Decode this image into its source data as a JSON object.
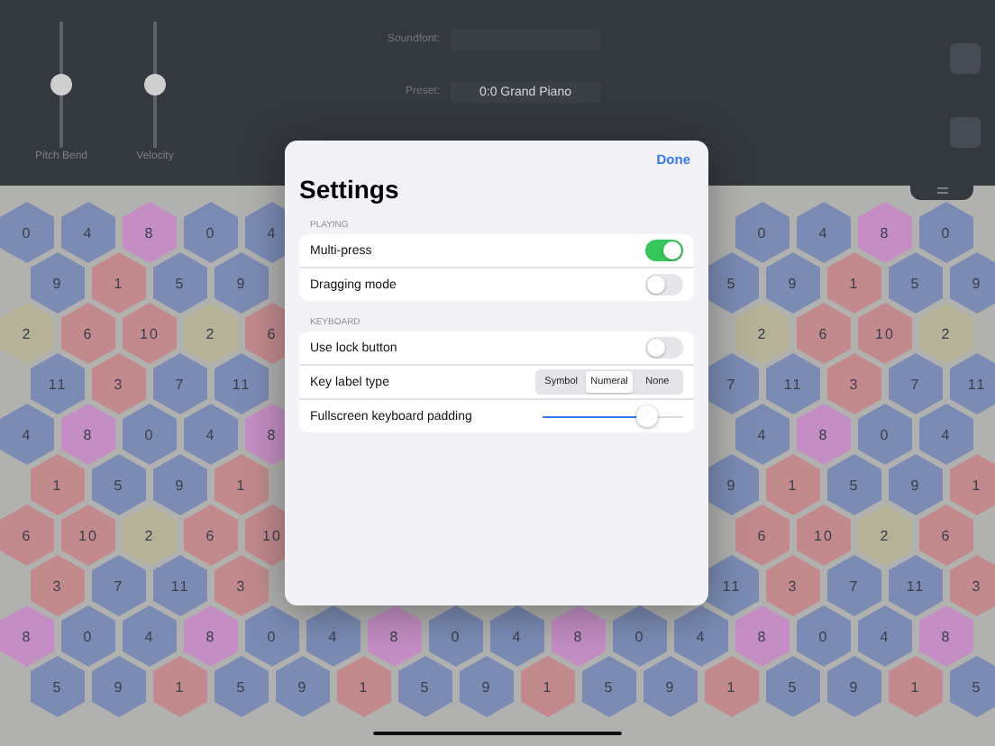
{
  "top_panel": {
    "sliders": [
      {
        "label": "Pitch Bend",
        "level": 0.5
      },
      {
        "label": "Velocity",
        "level": 0.5
      }
    ],
    "fields": [
      {
        "label": "Soundfont:"
      },
      {
        "label": "Preset:",
        "value": "0:0 Grand Piano"
      }
    ]
  },
  "keyboard": {
    "rows": [
      {
        "keys": [
          {
            "label": "0",
            "color": "#7b8bb4"
          },
          {
            "label": "4",
            "color": "#7b8bb4"
          },
          {
            "label": "8",
            "color": "#c48ec4"
          },
          {
            "label": "0",
            "color": "#7b8bb4"
          },
          {
            "label": "4",
            "color": "#7b8bb4"
          }
        ],
        "right_keys": [
          {
            "label": "0",
            "color": "#7b8bb4"
          },
          {
            "label": "4",
            "color": "#7b8bb4"
          },
          {
            "label": "8",
            "color": "#c48ec4"
          },
          {
            "label": "0",
            "color": "#7b8bb4"
          }
        ]
      },
      {
        "keys": [
          {
            "label": "9",
            "color": "#7b8bb4"
          },
          {
            "label": "1",
            "color": "#c38a8d"
          },
          {
            "label": "5",
            "color": "#7b8bb4"
          },
          {
            "label": "9",
            "color": "#7b8bb4"
          }
        ],
        "right_keys": [
          {
            "label": "5",
            "color": "#7b8bb4"
          },
          {
            "label": "9",
            "color": "#7b8bb4"
          },
          {
            "label": "1",
            "color": "#c38a8d"
          },
          {
            "label": "5",
            "color": "#7b8bb4"
          },
          {
            "label": "9",
            "color": "#7b8bb4"
          }
        ]
      },
      {
        "keys": [
          {
            "label": "2",
            "color": "#b5b297"
          },
          {
            "label": "6",
            "color": "#c38a8d"
          },
          {
            "label": "10",
            "color": "#c38a8d"
          },
          {
            "label": "2",
            "color": "#b5b297"
          },
          {
            "label": "6",
            "color": "#c38a8d"
          }
        ],
        "right_keys": [
          {
            "label": "2",
            "color": "#b5b297"
          },
          {
            "label": "6",
            "color": "#c38a8d"
          },
          {
            "label": "10",
            "color": "#c38a8d"
          },
          {
            "label": "2",
            "color": "#b5b297"
          }
        ]
      },
      {
        "keys": [
          {
            "label": "11",
            "color": "#7b8bb4"
          },
          {
            "label": "3",
            "color": "#c38a8d"
          },
          {
            "label": "7",
            "color": "#7b8bb4"
          },
          {
            "label": "11",
            "color": "#7b8bb4"
          }
        ],
        "right_keys": [
          {
            "label": "7",
            "color": "#7b8bb4"
          },
          {
            "label": "11",
            "color": "#7b8bb4"
          },
          {
            "label": "3",
            "color": "#c38a8d"
          },
          {
            "label": "7",
            "color": "#7b8bb4"
          },
          {
            "label": "11",
            "color": "#7b8bb4"
          }
        ]
      },
      {
        "keys": [
          {
            "label": "4",
            "color": "#7b8bb4"
          },
          {
            "label": "8",
            "color": "#c48ec4"
          },
          {
            "label": "0",
            "color": "#7b8bb4"
          },
          {
            "label": "4",
            "color": "#7b8bb4"
          },
          {
            "label": "8",
            "color": "#c48ec4"
          }
        ],
        "right_keys": [
          {
            "label": "4",
            "color": "#7b8bb4"
          },
          {
            "label": "8",
            "color": "#c48ec4"
          },
          {
            "label": "0",
            "color": "#7b8bb4"
          },
          {
            "label": "4",
            "color": "#7b8bb4"
          }
        ]
      },
      {
        "keys": [
          {
            "label": "1",
            "color": "#c38a8d"
          },
          {
            "label": "5",
            "color": "#7b8bb4"
          },
          {
            "label": "9",
            "color": "#7b8bb4"
          },
          {
            "label": "1",
            "color": "#c38a8d"
          }
        ],
        "right_keys": [
          {
            "label": "9",
            "color": "#7b8bb4"
          },
          {
            "label": "1",
            "color": "#c38a8d"
          },
          {
            "label": "5",
            "color": "#7b8bb4"
          },
          {
            "label": "9",
            "color": "#7b8bb4"
          },
          {
            "label": "1",
            "color": "#c38a8d"
          }
        ]
      },
      {
        "keys": [
          {
            "label": "6",
            "color": "#c38a8d"
          },
          {
            "label": "10",
            "color": "#c38a8d"
          },
          {
            "label": "2",
            "color": "#b5b297"
          },
          {
            "label": "6",
            "color": "#c38a8d"
          },
          {
            "label": "10",
            "color": "#c38a8d"
          }
        ],
        "right_keys": [
          {
            "label": "6",
            "color": "#c38a8d"
          },
          {
            "label": "10",
            "color": "#c38a8d"
          },
          {
            "label": "2",
            "color": "#b5b297"
          },
          {
            "label": "6",
            "color": "#c38a8d"
          }
        ]
      },
      {
        "keys": [
          {
            "label": "3",
            "color": "#c38a8d"
          },
          {
            "label": "7",
            "color": "#7b8bb4"
          },
          {
            "label": "11",
            "color": "#7b8bb4"
          },
          {
            "label": "3",
            "color": "#c38a8d"
          }
        ],
        "right_keys": [
          {
            "label": "11",
            "color": "#7b8bb4"
          },
          {
            "label": "3",
            "color": "#c38a8d"
          },
          {
            "label": "7",
            "color": "#7b8bb4"
          },
          {
            "label": "11",
            "color": "#7b8bb4"
          },
          {
            "label": "3",
            "color": "#c38a8d"
          }
        ]
      },
      {
        "keys": [
          {
            "label": "8",
            "color": "#c48ec4"
          },
          {
            "label": "0",
            "color": "#7b8bb4"
          },
          {
            "label": "4",
            "color": "#7b8bb4"
          },
          {
            "label": "8",
            "color": "#c48ec4"
          },
          {
            "label": "0",
            "color": "#7b8bb4"
          },
          {
            "label": "4",
            "color": "#7b8bb4"
          },
          {
            "label": "8",
            "color": "#c48ec4"
          },
          {
            "label": "0",
            "color": "#7b8bb4"
          },
          {
            "label": "4",
            "color": "#7b8bb4"
          },
          {
            "label": "8",
            "color": "#c48ec4"
          },
          {
            "label": "0",
            "color": "#7b8bb4"
          },
          {
            "label": "4",
            "color": "#7b8bb4"
          },
          {
            "label": "8",
            "color": "#c48ec4"
          },
          {
            "label": "0",
            "color": "#7b8bb4"
          },
          {
            "label": "4",
            "color": "#7b8bb4"
          },
          {
            "label": "8",
            "color": "#c48ec4"
          }
        ]
      },
      {
        "keys": [
          {
            "label": "5",
            "color": "#7b8bb4"
          },
          {
            "label": "9",
            "color": "#7b8bb4"
          },
          {
            "label": "1",
            "color": "#c38a8d"
          },
          {
            "label": "5",
            "color": "#7b8bb4"
          },
          {
            "label": "9",
            "color": "#7b8bb4"
          },
          {
            "label": "1",
            "color": "#c38a8d"
          },
          {
            "label": "5",
            "color": "#7b8bb4"
          },
          {
            "label": "9",
            "color": "#7b8bb4"
          },
          {
            "label": "1",
            "color": "#c38a8d"
          },
          {
            "label": "5",
            "color": "#7b8bb4"
          },
          {
            "label": "9",
            "color": "#7b8bb4"
          },
          {
            "label": "1",
            "color": "#c38a8d"
          },
          {
            "label": "5",
            "color": "#7b8bb4"
          },
          {
            "label": "9",
            "color": "#7b8bb4"
          },
          {
            "label": "1",
            "color": "#c38a8d"
          },
          {
            "label": "5",
            "color": "#7b8bb4"
          }
        ]
      }
    ]
  },
  "settings": {
    "title": "Settings",
    "done": "Done",
    "sections": [
      {
        "header": "PLAYING",
        "rows": [
          {
            "kind": "toggle",
            "label": "Multi-press",
            "on": true
          },
          {
            "kind": "toggle",
            "label": "Dragging mode",
            "on": false
          }
        ]
      },
      {
        "header": "KEYBOARD",
        "rows": [
          {
            "kind": "toggle",
            "label": "Use lock button",
            "on": false
          },
          {
            "kind": "segmented",
            "label": "Key label type",
            "options": [
              {
                "label": "Symbol",
                "selected": false
              },
              {
                "label": "Numeral",
                "selected": true
              },
              {
                "label": "None",
                "selected": false
              }
            ]
          },
          {
            "kind": "slider",
            "label": "Fullscreen keyboard padding",
            "level": 0.74
          }
        ]
      }
    ]
  }
}
